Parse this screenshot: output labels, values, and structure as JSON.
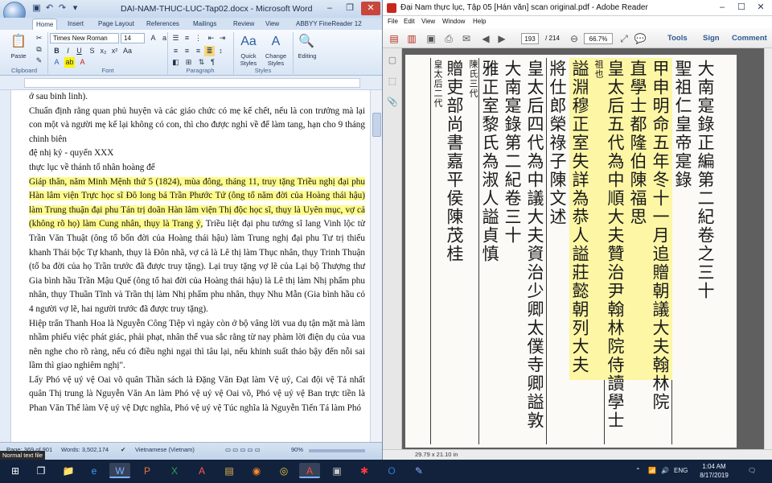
{
  "word": {
    "title": "DAI-NAM-THUC-LUC-Tap02.docx - Microsoft Word",
    "tabs": [
      "Home",
      "Insert",
      "Page Layout",
      "References",
      "Mailings",
      "Review",
      "View",
      "ABBYY FineReader 12"
    ],
    "font_name": "Times New Roman",
    "font_size": "14",
    "groups": [
      "Clipboard",
      "Font",
      "Paragraph",
      "Styles"
    ],
    "paste_label": "Paste",
    "quick_styles": "Quick Styles",
    "change_styles": "Change Styles",
    "editing": "Editing",
    "paragraphs": [
      "ớ sau binh linh).",
      "Chuẩn định rằng quan phủ huyện và các giáo chức có mẹ kế chết, nếu là con trưởng mà lại con một và người mẹ kế lại không có con, thì cho được nghỉ về để làm tang, hạn cho 9 tháng chinh biên",
      "đệ nhị kỷ - quyển XXX",
      "thực lục về thánh tổ nhân hoàng đế",
      "Giáp thân, năm Minh Mệnh thứ 5 (1824), mùa đông, tháng 11, truy tặng Triều nghị đại phu Hàn lâm viện Trực học sĩ Đô long bá Trần Phước Tứ (ông tổ năm đời của Hoàng thái hậu) làm Trung thuận đại phu Tán trị doãn Hàn lâm viện Thị độc học sĩ, thụy là Uyên mục, vợ cả (không rõ họ) làm Cung nhân, thụy là Trang ý,",
      "Triều liệt đại phu tướng sĩ lang Vinh lộc tử Trần Văn Thuật (ông tổ bốn đời của Hoàng thái hậu) làm Trung nghị đại phu Tư trị thiếu khanh Thái bộc Tự khanh, thụy là Đôn nhã, vợ cả là Lê thị làm Thục nhân, thụy Trinh Thuận (tổ ba đời của họ Trần trước đã được truy tặng). Lại truy tặng vợ lẽ của Lại bộ Thượng thư Gia bình hầu Trần Mậu Quế (ông tổ hai đời của Hoàng thái hậu) là Lê thị làm Nhị phẩm phu nhân, thụy Thuần Tĩnh và Trần thị làm Nhị phẩm phu nhân, thụy Nhu Mẫn (Gia bình hầu có 4 người vợ lẽ, hai người trước đã được truy tặng).",
      "Hiệp trấn Thanh Hoa là Nguyễn Công Tiệp vì ngày còn ở bộ vâng lời vua dụ tận mặt mà làm nhầm phiếu việc phát giác, phải phạt, nhân thể vua sắc rằng từ nay phàm lời điện dụ của vua nên nghe cho rõ ràng, nếu có điều nghi ngại thì tâu lại, nếu khinh suất thảo bậy đến nỗi sai lầm thì giao nghiêm nghị\".",
      "Lấy Phó vệ uý vệ Oai võ quân Thần sách là Đặng Văn Đạt làm Vệ uý, Cai đội vệ Tả nhất quân Thị trung là Nguyễn Văn An làm Phó vệ uý vệ Oai võ, Phó vệ uý vệ Ban trực tiền là Phan Văn Thể làm Vệ uý vệ Dực nghĩa, Phó vệ uý vệ Túc nghĩa là Nguyễn Tiến Tá làm Phó"
    ],
    "status": {
      "page": "Page: 369 of 901",
      "words": "Words: 3,502,174",
      "language": "Vietnamese (Vietnam)",
      "zoom": "90%",
      "style_hint": "Normal text file"
    }
  },
  "adobe": {
    "title": "Đại Nam thực lục, Tập 05 [Hán văn] scan original.pdf - Adobe Reader",
    "menu": [
      "File",
      "Edit",
      "View",
      "Window",
      "Help"
    ],
    "page_current": "193",
    "page_total": "/ 214",
    "zoom": "66.7%",
    "tools": "Tools",
    "sign": "Sign",
    "comment": "Comment",
    "page_size": "29.79 x 21.10 in",
    "columns": [
      {
        "text": "大南寔錄正編第二紀卷之三十",
        "size": "big",
        "hl": false
      },
      {
        "text": "聖祖仁皇帝寔錄",
        "size": "big",
        "hl": false
      },
      {
        "text": "甲申明命五年冬十一月追贈朝議大夫翰林院",
        "size": "big",
        "hl": true
      },
      {
        "text": "直學士都隆伯陳福思",
        "size": "big",
        "hl": true
      },
      {
        "text": "皇太后五代為中順大夫贊治尹翰林院侍讀學士",
        "size": "big",
        "hl": true
      },
      {
        "text": "祖也",
        "size": "sm",
        "hl": true
      },
      {
        "text": "謚淵穆正室失詳為恭人謚莊懿朝列大夫",
        "size": "big",
        "hl": true
      },
      {
        "text": "將仕郎榮祿子陳文述",
        "size": "big",
        "hl": false
      },
      {
        "text": "皇太后四代為中議大夫資治少卿太僕寺卿謚敦",
        "size": "big",
        "hl": false
      },
      {
        "text": "大南寔錄第二紀卷三十",
        "size": "big",
        "hl": false
      },
      {
        "text": "雅正室黎氏為淑人謚貞慎",
        "size": "big",
        "hl": false
      },
      {
        "text": "陳氏三代",
        "size": "sm",
        "hl": false
      },
      {
        "text": "贈吏部尚書嘉平侯陳茂桂",
        "size": "big",
        "hl": false
      },
      {
        "text": "皇太后二代",
        "size": "sm",
        "hl": false
      }
    ]
  },
  "taskbar": {
    "lang": "ENG",
    "time": "1:04 AM",
    "date": "8/17/2019"
  }
}
